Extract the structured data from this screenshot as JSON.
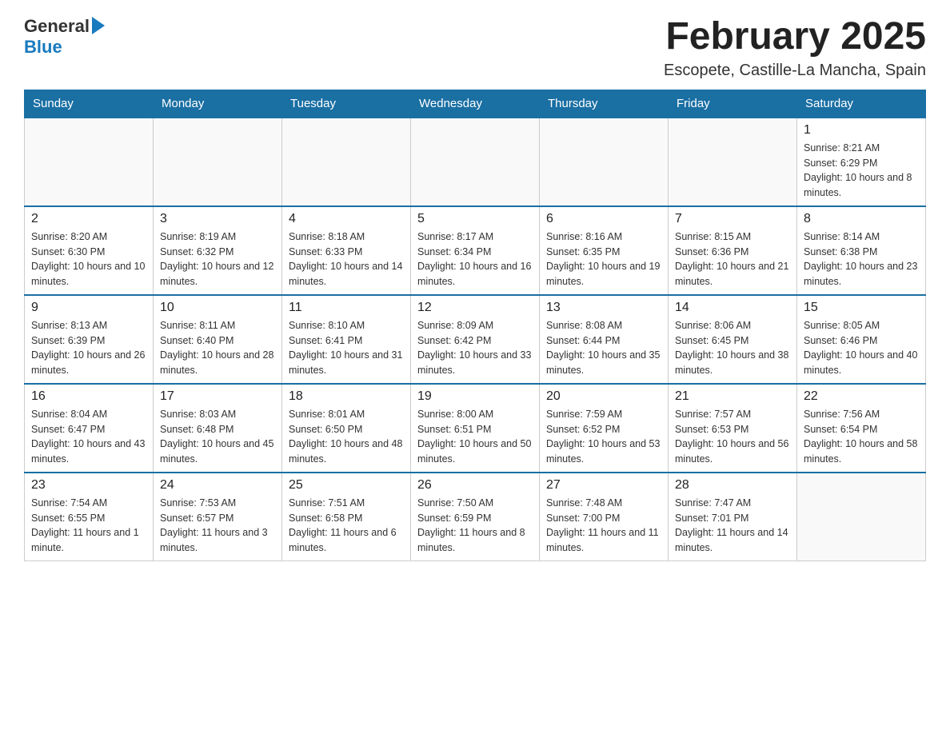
{
  "header": {
    "logo_general": "General",
    "logo_blue": "Blue",
    "month_title": "February 2025",
    "location": "Escopete, Castille-La Mancha, Spain"
  },
  "weekdays": [
    "Sunday",
    "Monday",
    "Tuesday",
    "Wednesday",
    "Thursday",
    "Friday",
    "Saturday"
  ],
  "weeks": [
    [
      {
        "day": "",
        "info": ""
      },
      {
        "day": "",
        "info": ""
      },
      {
        "day": "",
        "info": ""
      },
      {
        "day": "",
        "info": ""
      },
      {
        "day": "",
        "info": ""
      },
      {
        "day": "",
        "info": ""
      },
      {
        "day": "1",
        "info": "Sunrise: 8:21 AM\nSunset: 6:29 PM\nDaylight: 10 hours and 8 minutes."
      }
    ],
    [
      {
        "day": "2",
        "info": "Sunrise: 8:20 AM\nSunset: 6:30 PM\nDaylight: 10 hours and 10 minutes."
      },
      {
        "day": "3",
        "info": "Sunrise: 8:19 AM\nSunset: 6:32 PM\nDaylight: 10 hours and 12 minutes."
      },
      {
        "day": "4",
        "info": "Sunrise: 8:18 AM\nSunset: 6:33 PM\nDaylight: 10 hours and 14 minutes."
      },
      {
        "day": "5",
        "info": "Sunrise: 8:17 AM\nSunset: 6:34 PM\nDaylight: 10 hours and 16 minutes."
      },
      {
        "day": "6",
        "info": "Sunrise: 8:16 AM\nSunset: 6:35 PM\nDaylight: 10 hours and 19 minutes."
      },
      {
        "day": "7",
        "info": "Sunrise: 8:15 AM\nSunset: 6:36 PM\nDaylight: 10 hours and 21 minutes."
      },
      {
        "day": "8",
        "info": "Sunrise: 8:14 AM\nSunset: 6:38 PM\nDaylight: 10 hours and 23 minutes."
      }
    ],
    [
      {
        "day": "9",
        "info": "Sunrise: 8:13 AM\nSunset: 6:39 PM\nDaylight: 10 hours and 26 minutes."
      },
      {
        "day": "10",
        "info": "Sunrise: 8:11 AM\nSunset: 6:40 PM\nDaylight: 10 hours and 28 minutes."
      },
      {
        "day": "11",
        "info": "Sunrise: 8:10 AM\nSunset: 6:41 PM\nDaylight: 10 hours and 31 minutes."
      },
      {
        "day": "12",
        "info": "Sunrise: 8:09 AM\nSunset: 6:42 PM\nDaylight: 10 hours and 33 minutes."
      },
      {
        "day": "13",
        "info": "Sunrise: 8:08 AM\nSunset: 6:44 PM\nDaylight: 10 hours and 35 minutes."
      },
      {
        "day": "14",
        "info": "Sunrise: 8:06 AM\nSunset: 6:45 PM\nDaylight: 10 hours and 38 minutes."
      },
      {
        "day": "15",
        "info": "Sunrise: 8:05 AM\nSunset: 6:46 PM\nDaylight: 10 hours and 40 minutes."
      }
    ],
    [
      {
        "day": "16",
        "info": "Sunrise: 8:04 AM\nSunset: 6:47 PM\nDaylight: 10 hours and 43 minutes."
      },
      {
        "day": "17",
        "info": "Sunrise: 8:03 AM\nSunset: 6:48 PM\nDaylight: 10 hours and 45 minutes."
      },
      {
        "day": "18",
        "info": "Sunrise: 8:01 AM\nSunset: 6:50 PM\nDaylight: 10 hours and 48 minutes."
      },
      {
        "day": "19",
        "info": "Sunrise: 8:00 AM\nSunset: 6:51 PM\nDaylight: 10 hours and 50 minutes."
      },
      {
        "day": "20",
        "info": "Sunrise: 7:59 AM\nSunset: 6:52 PM\nDaylight: 10 hours and 53 minutes."
      },
      {
        "day": "21",
        "info": "Sunrise: 7:57 AM\nSunset: 6:53 PM\nDaylight: 10 hours and 56 minutes."
      },
      {
        "day": "22",
        "info": "Sunrise: 7:56 AM\nSunset: 6:54 PM\nDaylight: 10 hours and 58 minutes."
      }
    ],
    [
      {
        "day": "23",
        "info": "Sunrise: 7:54 AM\nSunset: 6:55 PM\nDaylight: 11 hours and 1 minute."
      },
      {
        "day": "24",
        "info": "Sunrise: 7:53 AM\nSunset: 6:57 PM\nDaylight: 11 hours and 3 minutes."
      },
      {
        "day": "25",
        "info": "Sunrise: 7:51 AM\nSunset: 6:58 PM\nDaylight: 11 hours and 6 minutes."
      },
      {
        "day": "26",
        "info": "Sunrise: 7:50 AM\nSunset: 6:59 PM\nDaylight: 11 hours and 8 minutes."
      },
      {
        "day": "27",
        "info": "Sunrise: 7:48 AM\nSunset: 7:00 PM\nDaylight: 11 hours and 11 minutes."
      },
      {
        "day": "28",
        "info": "Sunrise: 7:47 AM\nSunset: 7:01 PM\nDaylight: 11 hours and 14 minutes."
      },
      {
        "day": "",
        "info": ""
      }
    ]
  ]
}
